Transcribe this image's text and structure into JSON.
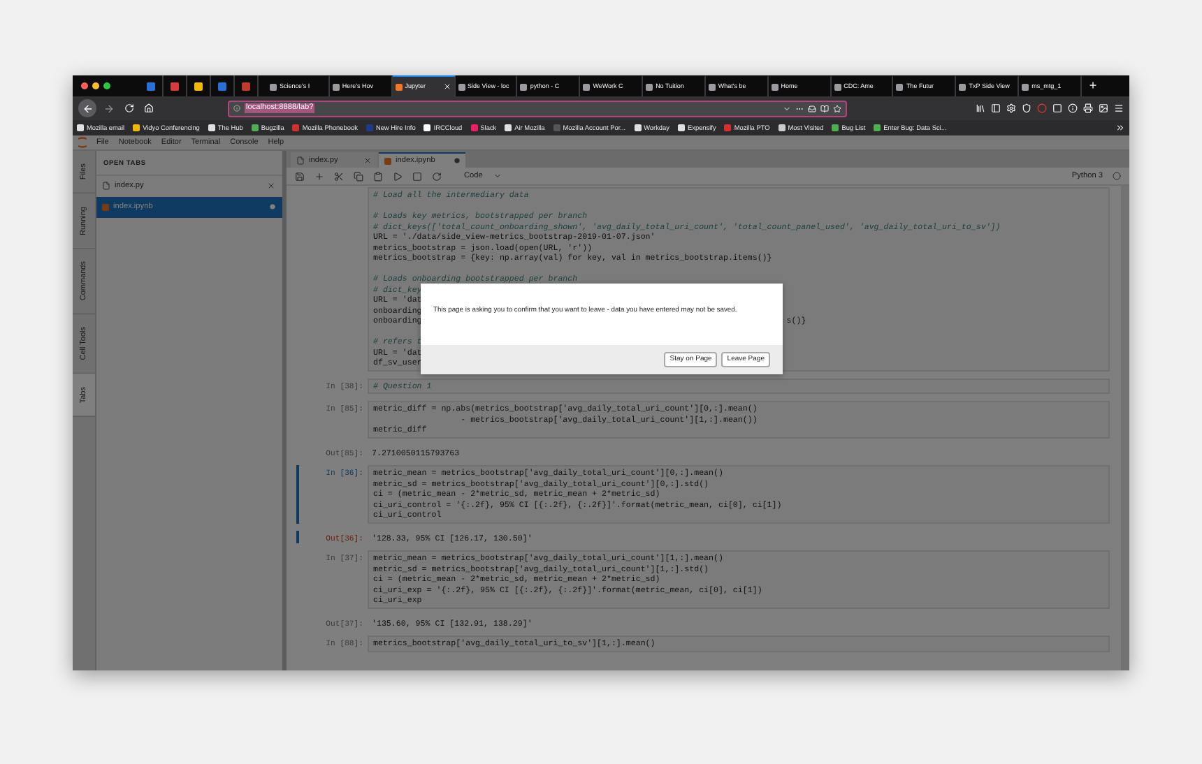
{
  "browser": {
    "pinned_tabs": [
      {
        "color": "#2a6fd6"
      },
      {
        "color": "#d93a3a"
      },
      {
        "color": "#f2b705"
      },
      {
        "color": "#2a6fd6"
      },
      {
        "color": "#c0392b"
      }
    ],
    "tabs": [
      {
        "title": "Science's I",
        "selected": false
      },
      {
        "title": "Here's Hov",
        "selected": false
      },
      {
        "title": "Jupyter",
        "selected": true
      },
      {
        "title": "Side View - loc",
        "selected": false
      },
      {
        "title": "python - C",
        "selected": false
      },
      {
        "title": "WeWork C",
        "selected": false
      },
      {
        "title": "No Tuition",
        "selected": false
      },
      {
        "title": "What's be",
        "selected": false
      },
      {
        "title": "Home",
        "selected": false
      },
      {
        "title": "CDC: Ame",
        "selected": false
      },
      {
        "title": "The Futur",
        "selected": false
      },
      {
        "title": "TxP Side View",
        "selected": false
      },
      {
        "title": "ms_mtg_1",
        "selected": false
      }
    ],
    "new_tab": "+",
    "url": {
      "value": "localhost:8888/lab?",
      "text_selected": true
    },
    "bookmarks": [
      {
        "label": "Mozilla email",
        "color": "#e0e0e0"
      },
      {
        "label": "Vidyo Conferencing",
        "color": "#f2b705"
      },
      {
        "label": "The Hub",
        "color": "#e0e0e0"
      },
      {
        "label": "Bugzilla",
        "color": "#4caf50"
      },
      {
        "label": "Mozilla Phonebook",
        "color": "#d32f2f"
      },
      {
        "label": "New Hire Info",
        "color": "#1e3a8a"
      },
      {
        "label": "IRCCloud",
        "color": "#ffffff"
      },
      {
        "label": "Slack",
        "color": "#e91e63"
      },
      {
        "label": "Air Mozilla",
        "color": "#e0e0e0"
      },
      {
        "label": "Mozilla Account Por...",
        "color": "#555555"
      },
      {
        "label": "Workday",
        "color": "#e0e0e0"
      },
      {
        "label": "Expensify",
        "color": "#e0e0e0"
      },
      {
        "label": "Mozilla PTO",
        "color": "#d32f2f"
      },
      {
        "label": "Most Visited",
        "color": "#cccccc"
      },
      {
        "label": "Bug List",
        "color": "#4caf50"
      },
      {
        "label": "Enter Bug: Data Sci...",
        "color": "#4caf50"
      }
    ]
  },
  "jupyter": {
    "menu": [
      "File",
      "Notebook",
      "Editor",
      "Terminal",
      "Console",
      "Help"
    ],
    "side_tabs": [
      {
        "label": "Files",
        "selected": false
      },
      {
        "label": "Running",
        "selected": false
      },
      {
        "label": "Commands",
        "selected": false
      },
      {
        "label": "Cell Tools",
        "selected": false
      },
      {
        "label": "Tabs",
        "selected": true
      }
    ],
    "sidebar": {
      "title": "OPEN TABS",
      "items": [
        {
          "name": "index.py",
          "kind": "file",
          "selected": false,
          "modified": false
        },
        {
          "name": "index.ipynb",
          "kind": "notebook",
          "selected": true,
          "modified": true
        }
      ]
    },
    "doc_tabs": [
      {
        "name": "index.py",
        "kind": "file",
        "selected": false,
        "modified": false
      },
      {
        "name": "index.ipynb",
        "kind": "notebook",
        "selected": true,
        "modified": true
      }
    ],
    "cell_type": "Code",
    "kernel": "Python 3",
    "cells": [
      {
        "selected": false,
        "blocks": [
          [
            {
              "text": "# Load all the intermediary data",
              "kind": "comment"
            }
          ],
          [
            {
              "text": "# Loads key metrics, bootstrapped per branch",
              "kind": "comment"
            },
            {
              "text": "# dict_keys(['total_count_onboarding_shown', 'avg_daily_total_uri_count', 'total_count_panel_used', 'avg_daily_total_uri_to_sv'])",
              "kind": "comment"
            },
            {
              "text": "URL = './data/side_view-metrics_bootstrap-2019-01-07.json'",
              "kind": "code"
            },
            {
              "text": "metrics_bootstrap = json.load(open(URL, 'r'))",
              "kind": "code"
            },
            {
              "text": "metrics_bootstrap = {key: np.array(val) for key, val in metrics_bootstrap.items()}",
              "kind": "code"
            }
          ],
          [
            {
              "text": "# Loads onboarding bootstrapped per branch",
              "kind": "comment"
            },
            {
              "text": "# dict_key",
              "kind": "comment"
            },
            {
              "text": "URL = 'dat",
              "kind": "code"
            },
            {
              "text": "onboarding",
              "kind": "code"
            },
            {
              "text": "onboarding",
              "kind": "code",
              "tail": "s()}"
            }
          ],
          [
            {
              "text": "# refers t",
              "kind": "comment"
            },
            {
              "text": "URL = 'dat",
              "kind": "code"
            },
            {
              "text": "df_sv_user",
              "kind": "code"
            }
          ]
        ]
      },
      {
        "prompt": "In [38]:",
        "selected": false,
        "blocks": [
          [
            {
              "text": "# Question 1",
              "kind": "comment"
            }
          ]
        ]
      },
      {
        "prompt": "In [85]:",
        "selected": false,
        "blocks": [
          [
            {
              "text": "metric_diff = np.abs(metrics_bootstrap['avg_daily_total_uri_count'][0,:].mean()",
              "kind": "code"
            },
            {
              "text": "                  - metrics_bootstrap['avg_daily_total_uri_count'][1,:].mean())",
              "kind": "code"
            },
            {
              "text": "metric_diff",
              "kind": "code"
            }
          ]
        ],
        "output": {
          "prompt": "Out[85]:",
          "text": "7.2710050115793763"
        }
      },
      {
        "prompt": "In [36]:",
        "selected": true,
        "blocks": [
          [
            {
              "text": "metric_mean = metrics_bootstrap['avg_daily_total_uri_count'][0,:].mean()",
              "kind": "code"
            },
            {
              "text": "metric_sd = metrics_bootstrap['avg_daily_total_uri_count'][0,:].std()",
              "kind": "code"
            },
            {
              "text": "ci = (metric_mean - 2*metric_sd, metric_mean + 2*metric_sd)",
              "kind": "code"
            },
            {
              "text": "ci_uri_control = '{:.2f}, 95% CI [{:.2f}, {:.2f}]'.format(metric_mean, ci[0], ci[1])",
              "kind": "code"
            },
            {
              "text": "ci_uri_control",
              "kind": "code"
            }
          ]
        ],
        "output": {
          "prompt": "Out[36]:",
          "text": "'128.33, 95% CI [126.17, 130.50]'"
        }
      },
      {
        "prompt": "In [37]:",
        "selected": false,
        "blocks": [
          [
            {
              "text": "metric_mean = metrics_bootstrap['avg_daily_total_uri_count'][1,:].mean()",
              "kind": "code"
            },
            {
              "text": "metric_sd = metrics_bootstrap['avg_daily_total_uri_count'][1,:].std()",
              "kind": "code"
            },
            {
              "text": "ci = (metric_mean - 2*metric_sd, metric_mean + 2*metric_sd)",
              "kind": "code"
            },
            {
              "text": "ci_uri_exp = '{:.2f}, 95% CI [{:.2f}, {:.2f}]'.format(metric_mean, ci[0], ci[1])",
              "kind": "code"
            },
            {
              "text": "ci_uri_exp",
              "kind": "code"
            }
          ]
        ],
        "output": {
          "prompt": "Out[37]:",
          "text": "'135.60, 95% CI [132.91, 138.29]'"
        }
      },
      {
        "prompt": "In [88]:",
        "selected": false,
        "blocks": [
          [
            {
              "text": "metrics_bootstrap['avg_daily_total_uri_to_sv'][1,:].mean()",
              "kind": "code"
            }
          ]
        ]
      }
    ]
  },
  "dialog": {
    "message": "This page is asking you to confirm that you want to leave - data you have entered may not be saved.",
    "buttons": [
      "Stay on Page",
      "Leave Page"
    ]
  }
}
